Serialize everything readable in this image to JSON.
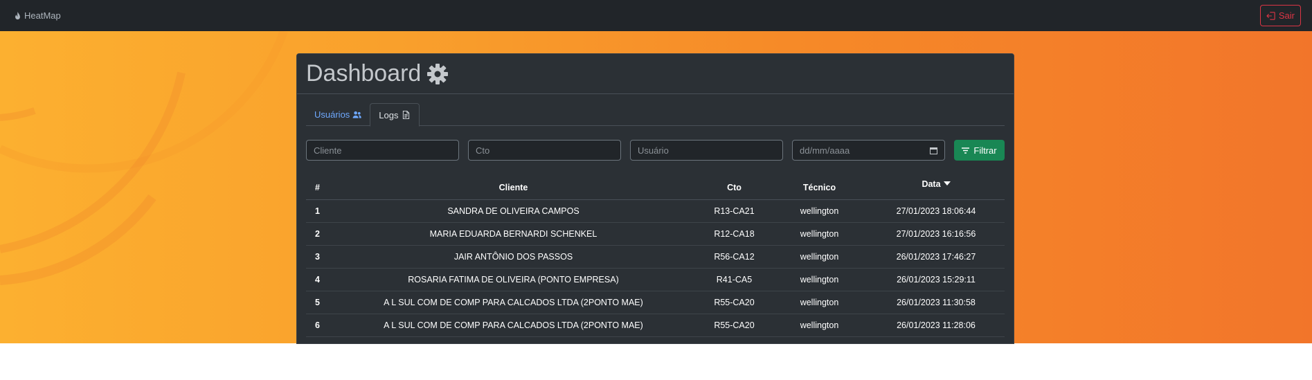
{
  "navbar": {
    "brand": "HeatMap",
    "brand_icon": "fire-icon",
    "logout_label": "Sair",
    "logout_icon": "logout-icon"
  },
  "colors": {
    "accent_orange": "#f7962a",
    "danger": "#dc3545",
    "success": "#198754",
    "link": "#6ea8fe"
  },
  "dashboard": {
    "title": "Dashboard",
    "title_icon": "gear-icon"
  },
  "tabs": [
    {
      "label": "Usuários",
      "icon": "users-icon",
      "active": false
    },
    {
      "label": "Logs",
      "icon": "file-icon",
      "active": true
    }
  ],
  "filters": {
    "cliente_placeholder": "Cliente",
    "cto_placeholder": "Cto",
    "usuario_placeholder": "Usuário",
    "date_placeholder": "dd/mm/aaaa",
    "button_label": "Filtrar"
  },
  "table": {
    "columns": [
      "#",
      "Cliente",
      "Cto",
      "Técnico",
      "Data"
    ],
    "sort_column": "Data",
    "sort_direction": "desc",
    "rows": [
      {
        "n": "1",
        "cliente": "SANDRA DE OLIVEIRA CAMPOS",
        "cto": "R13-CA21",
        "tecnico": "wellington",
        "data": "27/01/2023 18:06:44"
      },
      {
        "n": "2",
        "cliente": "MARIA EDUARDA BERNARDI SCHENKEL",
        "cto": "R12-CA18",
        "tecnico": "wellington",
        "data": "27/01/2023 16:16:56"
      },
      {
        "n": "3",
        "cliente": "JAIR ANTÔNIO DOS PASSOS",
        "cto": "R56-CA12",
        "tecnico": "wellington",
        "data": "26/01/2023 17:46:27"
      },
      {
        "n": "4",
        "cliente": "ROSARIA FATIMA DE OLIVEIRA (PONTO EMPRESA)",
        "cto": "R41-CA5",
        "tecnico": "wellington",
        "data": "26/01/2023 15:29:11"
      },
      {
        "n": "5",
        "cliente": "A L SUL COM DE COMP PARA CALCADOS LTDA (2PONTO MAE)",
        "cto": "R55-CA20",
        "tecnico": "wellington",
        "data": "26/01/2023 11:30:58"
      },
      {
        "n": "6",
        "cliente": "A L SUL COM DE COMP PARA CALCADOS LTDA (2PONTO MAE)",
        "cto": "R55-CA20",
        "tecnico": "wellington",
        "data": "26/01/2023 11:28:06"
      }
    ]
  }
}
